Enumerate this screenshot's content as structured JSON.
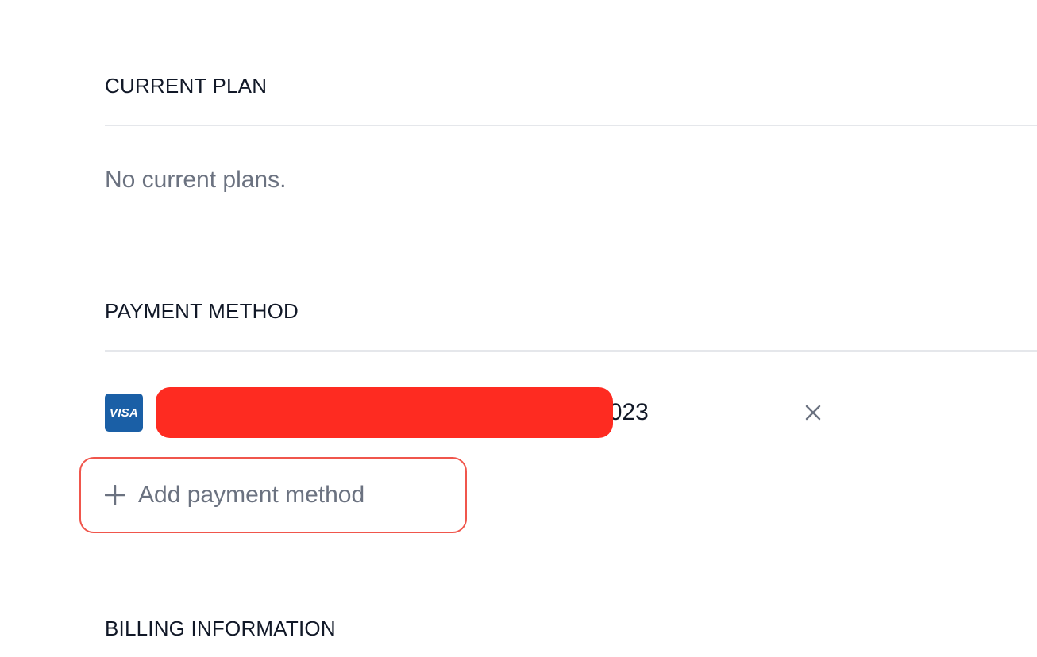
{
  "current_plan": {
    "heading": "CURRENT PLAN",
    "empty_message": "No current plans."
  },
  "payment_method": {
    "heading": "PAYMENT METHOD",
    "card": {
      "brand": "VISA",
      "details": "Expires 03/2023",
      "remove_icon": "close-icon"
    },
    "add_button": {
      "label": "Add payment method",
      "icon": "plus-icon"
    }
  },
  "billing_information": {
    "heading": "BILLING INFORMATION"
  },
  "colors": {
    "card_brand_bg": "#1a5fa6",
    "redaction": "#fe2b21",
    "highlight_border": "#f0564c",
    "heading_text": "#111827",
    "muted_text": "#6b7280",
    "divider": "#e5e7eb"
  }
}
